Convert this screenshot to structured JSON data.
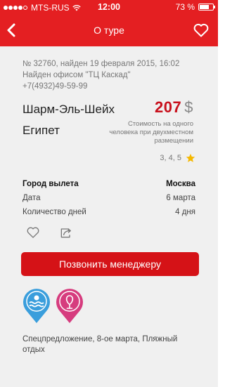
{
  "status_bar": {
    "carrier": "MTS-RUS",
    "time": "12:00",
    "battery": "73 %",
    "battery_level": 0.73
  },
  "nav": {
    "title": "О туре"
  },
  "tour": {
    "meta": {
      "line1": "№ 32760, найден 19 февраля 2015, 16:02",
      "line2": "Найден офисом  \"ТЦ Каскад\"",
      "phone": "+7(4932)49-59-99"
    },
    "city": "Шарм-Эль-Шейх",
    "country": "Египет",
    "price": "207",
    "currency": "$",
    "price_note": "Стоимость на одного человека при двухместном размещении",
    "star_ratings": "3, 4, 5",
    "details": [
      {
        "label": "Город вылета",
        "value": "Москва"
      },
      {
        "label": "Дата",
        "value": "6 марта"
      },
      {
        "label": "Количество дней",
        "value": "4 дня"
      }
    ],
    "call_button": "Позвонить менеджеру",
    "description": "Спецпредложение, 8-ое марта, Пляжный отдых"
  },
  "colors": {
    "brand_red": "#e41f22",
    "button_red": "#d51217",
    "price_red": "#c8101c",
    "star": "#f5b800",
    "pin_blue": "#3a9edc",
    "pin_pink": "#d63c7e"
  }
}
